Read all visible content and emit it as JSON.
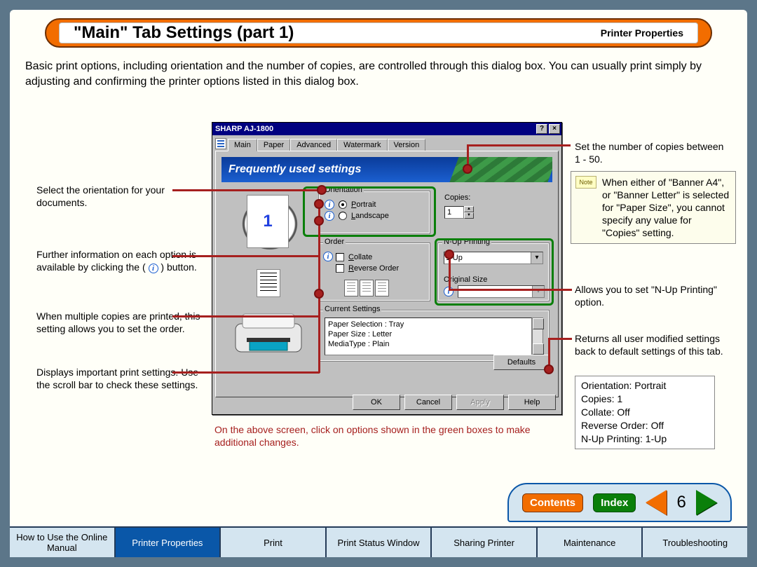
{
  "header": {
    "title": "\"Main\" Tab Settings (part 1)",
    "subtitle": "Printer Properties"
  },
  "intro": "Basic print options, including orientation and the number of copies, are controlled through this dialog box. You can usually print simply by adjusting and confirming the printer options listed in this dialog box.",
  "dialog": {
    "title": "SHARP AJ-1800",
    "tabs": [
      "Main",
      "Paper",
      "Advanced",
      "Watermark",
      "Version"
    ],
    "banner": "Frequently used settings",
    "preview_number": "1",
    "orientation": {
      "legend": "Orientation",
      "portrait": "Portrait",
      "landscape": "Landscape"
    },
    "copies": {
      "label": "Copies:",
      "value": "1"
    },
    "order": {
      "legend": "Order",
      "collate": "Collate",
      "reverse": "Reverse Order"
    },
    "nup": {
      "legend": "N-Up Printing",
      "value": "1-Up",
      "orig": "Original Size"
    },
    "current": {
      "legend": "Current Settings",
      "lines": [
        "Paper Selection : Tray",
        "Paper Size : Letter",
        "MediaType : Plain"
      ]
    },
    "defaults_btn": "Defaults",
    "buttons": {
      "ok": "OK",
      "cancel": "Cancel",
      "apply": "Apply",
      "help": "Help"
    }
  },
  "annotations": {
    "left1": "Select the orientation for your documents.",
    "left2_a": "Further information on each option is available by clicking the (",
    "left2_b": ") button.",
    "left3": "When multiple copies are printed, this setting allows you to set the order.",
    "left4": "Displays important print settings. Use the scroll bar to check these settings.",
    "right1": "Set the number of copies between 1 - 50.",
    "note": "When either of \"Banner A4\", or \"Banner Letter\" is selected for \"Paper Size\", you cannot specify any value for \"Copies\" setting.",
    "note_tag": "Note",
    "right2": "Allows you to set \"N-Up Printing\" option.",
    "right3": "Returns all user modified settings back to default settings of this tab.",
    "defaults_list": [
      "Orientation: Portrait",
      "Copies: 1",
      "Collate: Off",
      "Reverse Order: Off",
      "N-Up Printing: 1-Up"
    ],
    "red_hint": "On the above screen, click on options shown in the green boxes to make additional changes."
  },
  "pager": {
    "contents": "Contents",
    "index": "Index",
    "page": "6"
  },
  "footer": {
    "items": [
      "How to Use the Online Manual",
      "Printer Properties",
      "Print",
      "Print Status Window",
      "Sharing Printer",
      "Maintenance",
      "Troubleshooting"
    ],
    "active_index": 1
  }
}
